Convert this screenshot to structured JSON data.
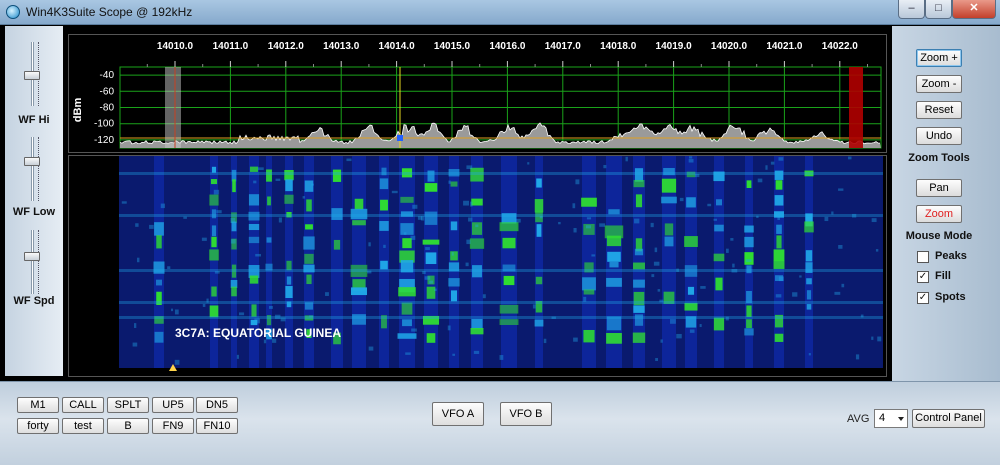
{
  "window": {
    "title": "Win4K3Suite Scope @ 192kHz",
    "min_glyph": "–",
    "max_glyph": "□",
    "close_glyph": "✕"
  },
  "sliders": [
    {
      "label": "WF Hi",
      "level": 0.55
    },
    {
      "label": "WF Low",
      "level": 0.55
    },
    {
      "label": "WF Spd",
      "level": 0.45
    }
  ],
  "spectrum": {
    "freq_labels": [
      "14010.0",
      "14011.0",
      "14012.0",
      "14013.0",
      "14014.0",
      "14015.0",
      "14016.0",
      "14017.0",
      "14018.0",
      "14019.0",
      "14020.0",
      "14021.0",
      "14022.0"
    ],
    "dbm_labels": [
      "-40",
      "-60",
      "-80",
      "-100",
      "-120"
    ],
    "ylabel": "dBm",
    "colors": {
      "grid": "#1aa31a",
      "trace_fill": "#9a9a9a",
      "trace_line": "#ffffff",
      "vfo_line": "#e6d820",
      "baseline": "#e0a020",
      "band_edge": "#b00000"
    }
  },
  "waterfall": {
    "spot": "3C7A: EQUATORIAL GUINEA",
    "colors": {
      "background": "#0a1a6e",
      "low": "#1030c0",
      "mid": "#20a8e8",
      "high": "#30e030"
    }
  },
  "zoom_tools": {
    "zoom_in": "Zoom +",
    "zoom_out": "Zoom -",
    "reset": "Reset",
    "undo": "Undo",
    "heading": "Zoom Tools"
  },
  "mouse_mode": {
    "pan": "Pan",
    "zoom": "Zoom",
    "heading": "Mouse Mode"
  },
  "options": [
    {
      "label": "Peaks",
      "checked": false
    },
    {
      "label": "Fill",
      "checked": true
    },
    {
      "label": "Spots",
      "checked": true
    }
  ],
  "macros_row1": [
    "M1",
    "CALL",
    "SPLT",
    "UP5",
    "DN5"
  ],
  "macros_row2": [
    "forty",
    "test",
    "B",
    "FN9",
    "FN10"
  ],
  "vfo": {
    "a": "VFO A",
    "b": "VFO B"
  },
  "avg": {
    "label": "AVG",
    "value": "4"
  },
  "control_panel": "Control Panel"
}
